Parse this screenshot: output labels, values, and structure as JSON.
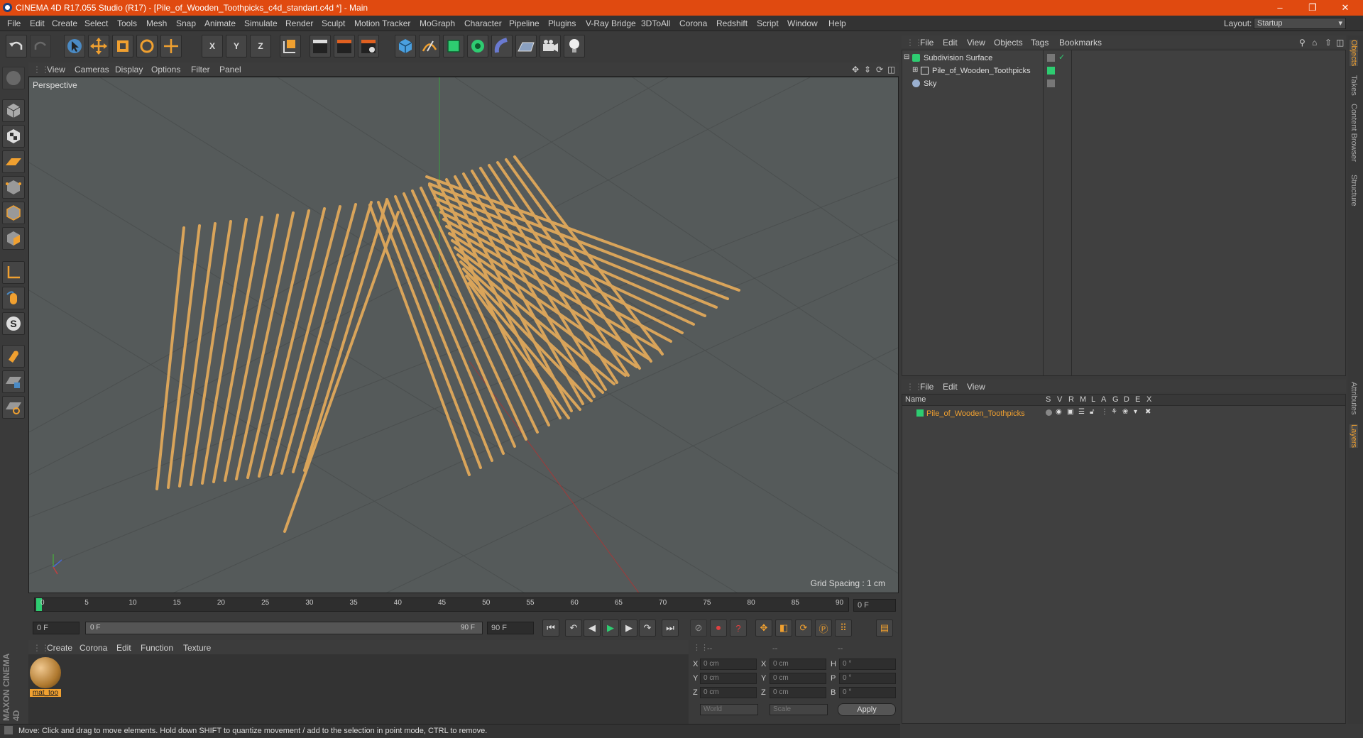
{
  "window": {
    "title": "CINEMA 4D R17.055 Studio (R17) - [Pile_of_Wooden_Toothpicks_c4d_standart.c4d *] - Main",
    "minimize": "–",
    "restore": "❐",
    "close": "✕"
  },
  "menubar": {
    "items": [
      "File",
      "Edit",
      "Create",
      "Select",
      "Tools",
      "Mesh",
      "Snap",
      "Animate",
      "Simulate",
      "Render",
      "Sculpt",
      "Motion Tracker",
      "MoGraph",
      "Character",
      "Pipeline",
      "Plugins",
      "V-Ray Bridge",
      "3DToAll",
      "Corona",
      "Redshift",
      "Script",
      "Window",
      "Help"
    ],
    "layout_label": "Layout:",
    "layout_value": "Startup"
  },
  "toolbar": {
    "axis_x": "X",
    "axis_y": "Y",
    "axis_z": "Z"
  },
  "viewport": {
    "menu": [
      "View",
      "Cameras",
      "Display",
      "Options",
      "Filter",
      "Panel"
    ],
    "label": "Perspective",
    "grid_spacing": "Grid Spacing : 1 cm"
  },
  "timeline": {
    "ticks": [
      "0",
      "5",
      "10",
      "15",
      "20",
      "25",
      "30",
      "35",
      "40",
      "45",
      "50",
      "55",
      "60",
      "65",
      "70",
      "75",
      "80",
      "85",
      "90"
    ],
    "current_frame": "0 F",
    "start_field": "0 F",
    "range_start": "0 F",
    "range_end": "90 F",
    "end_field": "90 F"
  },
  "material_manager": {
    "menu": [
      "Create",
      "Corona",
      "Edit",
      "Function",
      "Texture"
    ],
    "materials": [
      {
        "name": "mat_too"
      }
    ]
  },
  "coordinates": {
    "header": [
      "--",
      "--",
      "--"
    ],
    "rows": [
      {
        "label": "X",
        "pos": "0 cm",
        "label2": "X",
        "size": "0 cm",
        "label3": "H",
        "rot": "0 °"
      },
      {
        "label": "Y",
        "pos": "0 cm",
        "label2": "Y",
        "size": "0 cm",
        "label3": "P",
        "rot": "0 °"
      },
      {
        "label": "Z",
        "pos": "0 cm",
        "label2": "Z",
        "size": "0 cm",
        "label3": "B",
        "rot": "0 °"
      }
    ],
    "mode": "World",
    "scale": "Scale",
    "apply": "Apply"
  },
  "object_manager": {
    "menu": [
      "File",
      "Edit",
      "View",
      "Objects",
      "Tags",
      "Bookmarks"
    ],
    "objects": [
      {
        "name": "Subdivision Surface",
        "expand": "⊟"
      },
      {
        "name": "Pile_of_Wooden_Toothpicks",
        "expand": "⊞"
      },
      {
        "name": "Sky",
        "expand": ""
      }
    ]
  },
  "layer_manager": {
    "menu": [
      "File",
      "Edit",
      "View"
    ],
    "columns": [
      "Name",
      "S",
      "V",
      "R",
      "M",
      "L",
      "A",
      "G",
      "D",
      "E",
      "X"
    ],
    "layers": [
      {
        "name": "Pile_of_Wooden_Toothpicks",
        "color": "#2ecc71"
      }
    ]
  },
  "right_tabs": [
    "Objects",
    "Takes",
    "Content Browser",
    "Structure",
    "Attributes",
    "Layers"
  ],
  "brand": "MAXON CINEMA 4D",
  "status": "Move: Click and drag to move elements. Hold down SHIFT to quantize movement / add to the selection in point mode, CTRL to remove.",
  "colors": {
    "accent": "#e04a10",
    "toothpick": "#d9a45a",
    "layer_green": "#2ecc71",
    "highlight_orange": "#f0a030"
  }
}
